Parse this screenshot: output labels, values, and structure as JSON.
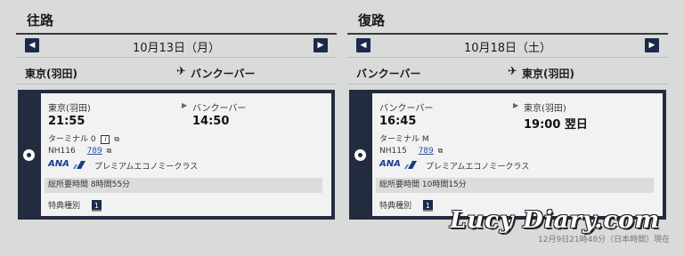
{
  "outbound": {
    "section_title": "往路",
    "date": "10月13日（月）",
    "route_from": "東京(羽田)",
    "route_to": "バンクーバー",
    "card": {
      "from": "東京(羽田)",
      "to": "バンクーバー",
      "dep_time": "21:55",
      "arr_time": "14:50",
      "terminal": "ターミナル 0",
      "flight_no": "NH116",
      "aircraft": "789",
      "airline_logo": "ANA",
      "cabin_class": "プレミアムエコノミークラス",
      "total_time": "総所要時間  8時間55分",
      "fare_label": "特典種別",
      "fare_badge": "1"
    }
  },
  "return": {
    "section_title": "復路",
    "date": "10月18日（土）",
    "route_from": "バンクーバー",
    "route_to": "東京(羽田)",
    "card": {
      "from": "バンクーバー",
      "to": "東京(羽田)",
      "dep_time": "16:45",
      "arr_time": "19:00 翌日",
      "terminal": "ターミナル M",
      "flight_no": "NH115",
      "aircraft": "789",
      "airline_logo": "ANA",
      "cabin_class": "プレミアムエコノミークラス",
      "total_time": "総所要時間  10時間15分",
      "fare_label": "特典種別",
      "fare_badge": "1"
    }
  },
  "icons": {
    "prev": "◀",
    "next": "▶",
    "plane": "✈",
    "arrow": "▶",
    "info": "i",
    "external": "⧉"
  },
  "watermark": "Lucy Diary.com",
  "footer_note": "12月9日21時48分（日本時間）現在",
  "colors": {
    "navy": "#232c3f",
    "nav_button": "#1b2a4a",
    "link": "#2a4f9a"
  }
}
